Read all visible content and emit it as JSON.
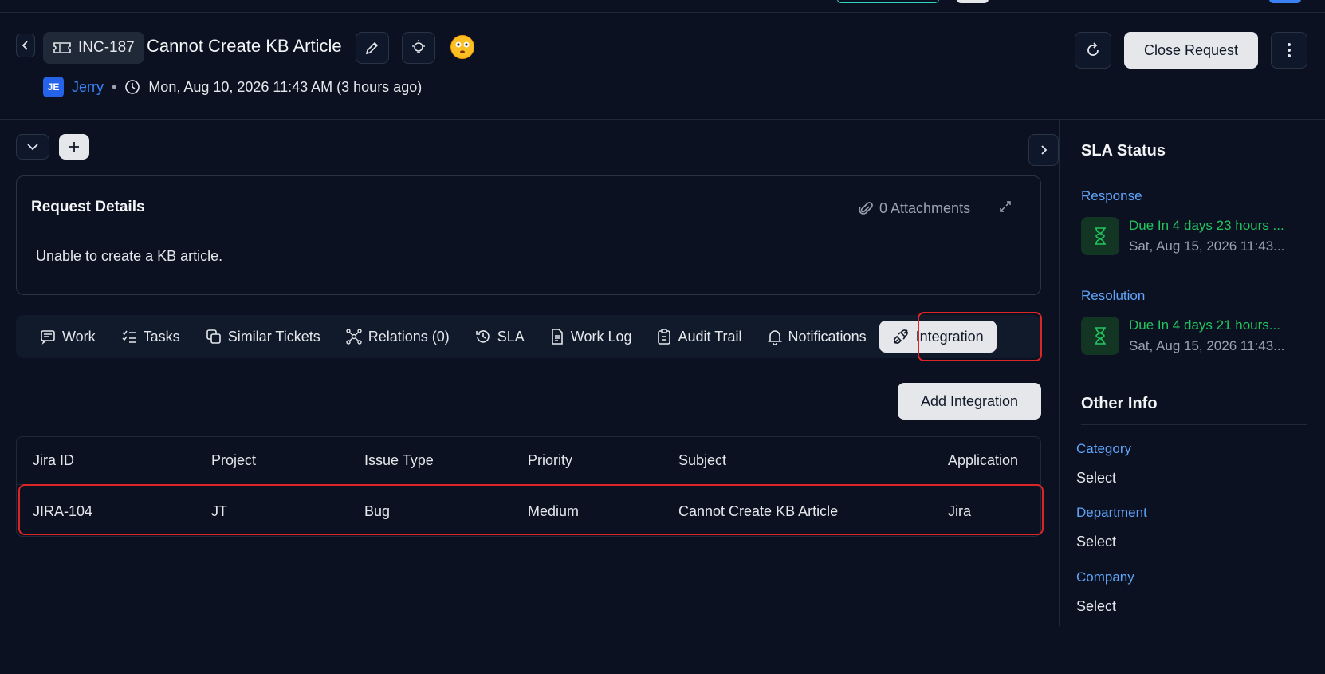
{
  "header": {
    "ticket_id": "INC-187",
    "title": "Cannot Create KB Article",
    "user_initials": "JE",
    "user_name": "Jerry",
    "separator": "•",
    "timestamp": "Mon, Aug 10, 2026 11:43 AM (3 hours ago)",
    "close_label": "Close Request"
  },
  "details": {
    "title": "Request Details",
    "attachments": "0 Attachments",
    "body": "Unable to create a KB article."
  },
  "tabs": [
    {
      "label": "Work",
      "icon": "message-icon"
    },
    {
      "label": "Tasks",
      "icon": "checklist-icon"
    },
    {
      "label": "Similar Tickets",
      "icon": "copy-icon"
    },
    {
      "label": "Relations (0)",
      "icon": "relations-icon"
    },
    {
      "label": "SLA",
      "icon": "history-icon"
    },
    {
      "label": "Work Log",
      "icon": "document-icon"
    },
    {
      "label": "Audit Trail",
      "icon": "clipboard-icon"
    },
    {
      "label": "Notifications",
      "icon": "bell-icon"
    },
    {
      "label": "Integration",
      "icon": "plug-icon",
      "active": true
    }
  ],
  "integration": {
    "add_label": "Add Integration",
    "columns": [
      "Jira ID",
      "Project",
      "Issue Type",
      "Priority",
      "Subject",
      "Application"
    ],
    "rows": [
      [
        "JIRA-104",
        "JT",
        "Bug",
        "Medium",
        "Cannot Create KB Article",
        "Jira"
      ]
    ]
  },
  "sidebar": {
    "sla_title": "SLA Status",
    "response_label": "Response",
    "response_due": "Due In 4 days 23 hours ...",
    "response_date": "Sat, Aug 15, 2026 11:43...",
    "resolution_label": "Resolution",
    "resolution_due": "Due In 4 days 21 hours...",
    "resolution_date": "Sat, Aug 15, 2026 11:43...",
    "other_title": "Other Info",
    "fields": [
      {
        "label": "Category",
        "value": "Select"
      },
      {
        "label": "Department",
        "value": "Select"
      },
      {
        "label": "Company",
        "value": "Select"
      }
    ]
  },
  "colors": {
    "background": "#0b1120",
    "accent_blue": "#3b82f6",
    "sla_green": "#22c55e",
    "highlight_red": "#dc2626"
  }
}
